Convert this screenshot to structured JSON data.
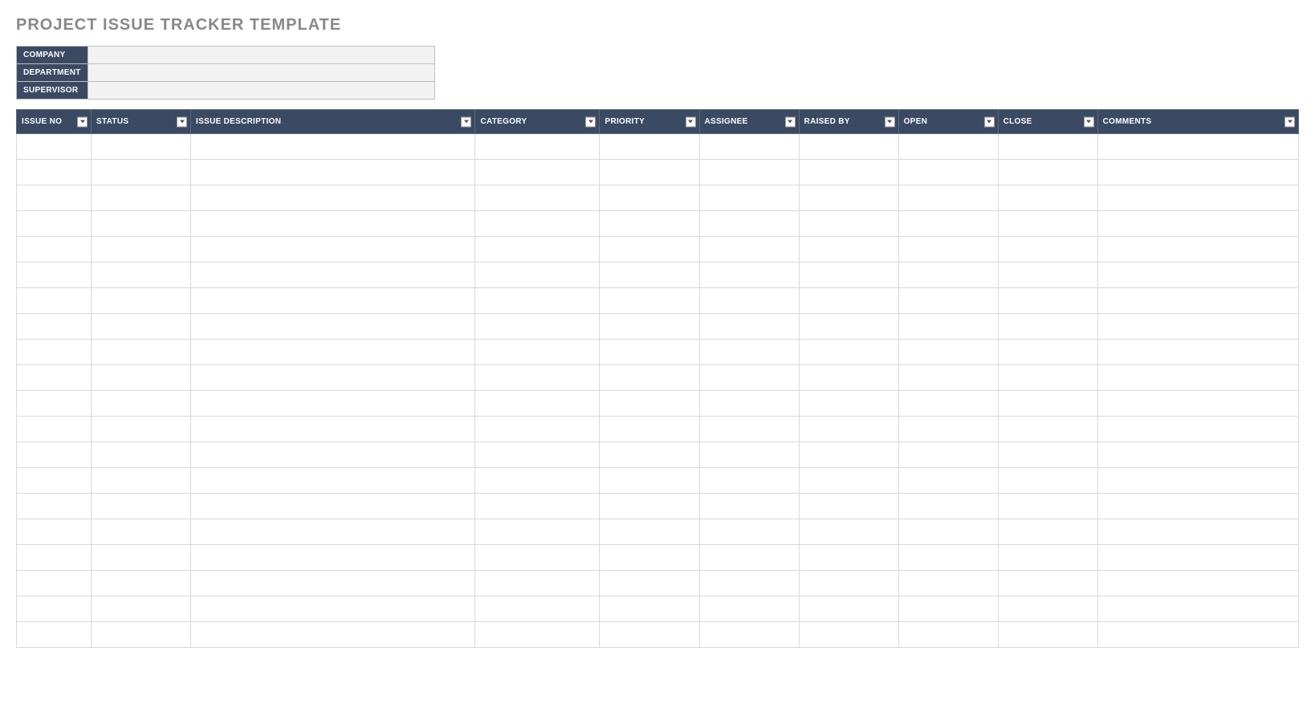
{
  "title": "PROJECT ISSUE TRACKER TEMPLATE",
  "meta": {
    "labels": {
      "company": "COMPANY",
      "department": "DEPARTMENT",
      "supervisor": "SUPERVISOR"
    },
    "values": {
      "company": "",
      "department": "",
      "supervisor": ""
    }
  },
  "columns": {
    "issue_no": "ISSUE NO",
    "status": "STATUS",
    "description": "ISSUE DESCRIPTION",
    "category": "CATEGORY",
    "priority": "PRIORITY",
    "assignee": "ASSIGNEE",
    "raised_by": "RAISED BY",
    "open": "OPEN",
    "close": "CLOSE",
    "comments": "COMMENTS"
  },
  "rows": [
    {
      "issue_no": "",
      "status": "",
      "description": "",
      "category": "",
      "priority": "",
      "assignee": "",
      "raised_by": "",
      "open": "",
      "close": "",
      "comments": ""
    },
    {
      "issue_no": "",
      "status": "",
      "description": "",
      "category": "",
      "priority": "",
      "assignee": "",
      "raised_by": "",
      "open": "",
      "close": "",
      "comments": ""
    },
    {
      "issue_no": "",
      "status": "",
      "description": "",
      "category": "",
      "priority": "",
      "assignee": "",
      "raised_by": "",
      "open": "",
      "close": "",
      "comments": ""
    },
    {
      "issue_no": "",
      "status": "",
      "description": "",
      "category": "",
      "priority": "",
      "assignee": "",
      "raised_by": "",
      "open": "",
      "close": "",
      "comments": ""
    },
    {
      "issue_no": "",
      "status": "",
      "description": "",
      "category": "",
      "priority": "",
      "assignee": "",
      "raised_by": "",
      "open": "",
      "close": "",
      "comments": ""
    },
    {
      "issue_no": "",
      "status": "",
      "description": "",
      "category": "",
      "priority": "",
      "assignee": "",
      "raised_by": "",
      "open": "",
      "close": "",
      "comments": ""
    },
    {
      "issue_no": "",
      "status": "",
      "description": "",
      "category": "",
      "priority": "",
      "assignee": "",
      "raised_by": "",
      "open": "",
      "close": "",
      "comments": ""
    },
    {
      "issue_no": "",
      "status": "",
      "description": "",
      "category": "",
      "priority": "",
      "assignee": "",
      "raised_by": "",
      "open": "",
      "close": "",
      "comments": ""
    },
    {
      "issue_no": "",
      "status": "",
      "description": "",
      "category": "",
      "priority": "",
      "assignee": "",
      "raised_by": "",
      "open": "",
      "close": "",
      "comments": ""
    },
    {
      "issue_no": "",
      "status": "",
      "description": "",
      "category": "",
      "priority": "",
      "assignee": "",
      "raised_by": "",
      "open": "",
      "close": "",
      "comments": ""
    },
    {
      "issue_no": "",
      "status": "",
      "description": "",
      "category": "",
      "priority": "",
      "assignee": "",
      "raised_by": "",
      "open": "",
      "close": "",
      "comments": ""
    },
    {
      "issue_no": "",
      "status": "",
      "description": "",
      "category": "",
      "priority": "",
      "assignee": "",
      "raised_by": "",
      "open": "",
      "close": "",
      "comments": ""
    },
    {
      "issue_no": "",
      "status": "",
      "description": "",
      "category": "",
      "priority": "",
      "assignee": "",
      "raised_by": "",
      "open": "",
      "close": "",
      "comments": ""
    },
    {
      "issue_no": "",
      "status": "",
      "description": "",
      "category": "",
      "priority": "",
      "assignee": "",
      "raised_by": "",
      "open": "",
      "close": "",
      "comments": ""
    },
    {
      "issue_no": "",
      "status": "",
      "description": "",
      "category": "",
      "priority": "",
      "assignee": "",
      "raised_by": "",
      "open": "",
      "close": "",
      "comments": ""
    },
    {
      "issue_no": "",
      "status": "",
      "description": "",
      "category": "",
      "priority": "",
      "assignee": "",
      "raised_by": "",
      "open": "",
      "close": "",
      "comments": ""
    },
    {
      "issue_no": "",
      "status": "",
      "description": "",
      "category": "",
      "priority": "",
      "assignee": "",
      "raised_by": "",
      "open": "",
      "close": "",
      "comments": ""
    },
    {
      "issue_no": "",
      "status": "",
      "description": "",
      "category": "",
      "priority": "",
      "assignee": "",
      "raised_by": "",
      "open": "",
      "close": "",
      "comments": ""
    },
    {
      "issue_no": "",
      "status": "",
      "description": "",
      "category": "",
      "priority": "",
      "assignee": "",
      "raised_by": "",
      "open": "",
      "close": "",
      "comments": ""
    },
    {
      "issue_no": "",
      "status": "",
      "description": "",
      "category": "",
      "priority": "",
      "assignee": "",
      "raised_by": "",
      "open": "",
      "close": "",
      "comments": ""
    }
  ]
}
